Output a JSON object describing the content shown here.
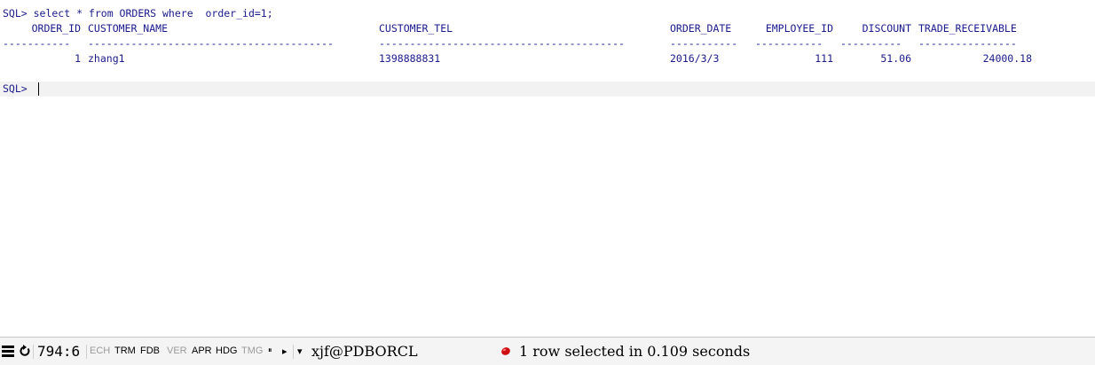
{
  "editor": {
    "query_line": "SQL> select * from ORDERS where  order_id=1;",
    "columns": [
      {
        "header": "ORDER_ID",
        "dashes": "-----------",
        "value": "1",
        "align": "right"
      },
      {
        "header": "CUSTOMER_NAME",
        "dashes": "----------------------------------------",
        "value": "zhang1",
        "align": "left"
      },
      {
        "header": "CUSTOMER_TEL",
        "dashes": "----------------------------------------",
        "value": "1398888831",
        "align": "left"
      },
      {
        "header": "ORDER_DATE",
        "dashes": "-----------",
        "value": "2016/3/3",
        "align": "left"
      },
      {
        "header": "EMPLOYEE_ID",
        "dashes": "-----------",
        "value": "111",
        "align": "right"
      },
      {
        "header": "DISCOUNT",
        "dashes": "----------",
        "value": "51.06",
        "align": "right"
      },
      {
        "header": "TRADE_RECEIVABLE",
        "dashes": "----------------",
        "value": "24000.18",
        "align": "right"
      }
    ],
    "prompt": "SQL>"
  },
  "statusbar": {
    "cursor_position": "794:6",
    "flags": [
      {
        "label": "ECH",
        "active": false
      },
      {
        "label": "TRM",
        "active": true
      },
      {
        "label": "FDB",
        "active": true
      },
      {
        "label": "VER",
        "active": false
      },
      {
        "label": "APR",
        "active": true
      },
      {
        "label": "HDG",
        "active": true
      },
      {
        "label": "TMG",
        "active": false
      }
    ],
    "pause_glyph": "⏸",
    "play_glyph": "▸",
    "dropdown_glyph": "▾",
    "connection": "xjf@PDBORCL",
    "message": "1 row selected in 0.109 seconds",
    "colors": {
      "text": "#1a1a8c",
      "message_icon": "#d01010"
    }
  }
}
